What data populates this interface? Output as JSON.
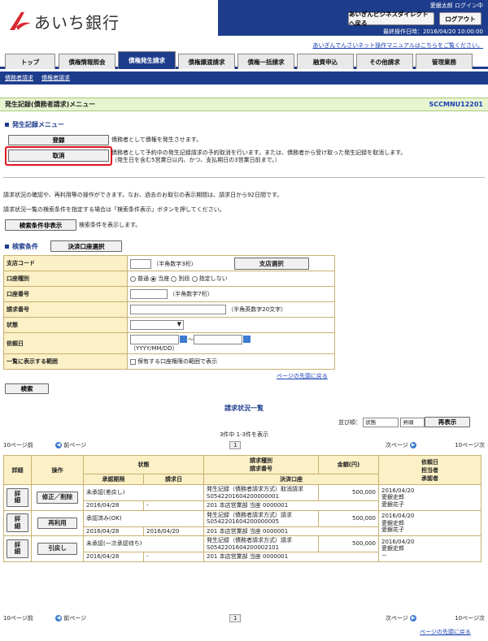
{
  "header": {
    "bank_name": "あいち銀行",
    "user": "愛銀太郎 ログイン中",
    "direct_button": "あいぎんビジネスダイレクトへ戻る",
    "logout_button": "ログアウト",
    "last_operation": "最終操作日時：2016/04/20 10:00:00",
    "manual_link": "あいぎんでんさいネット操作マニュアルはこちらをご覧ください。",
    "accent": "#1d3c8c"
  },
  "tabs": [
    "トップ",
    "債権情報照会",
    "債権発生請求",
    "債権譲渡請求",
    "債権一括請求",
    "融資申込",
    "その他請求",
    "管理業務"
  ],
  "subnav": [
    "債務者請求",
    "債権者請求"
  ],
  "title": {
    "text": "発生記録(債務者請求)メニュー",
    "code": "SCCMNU12201"
  },
  "menu": {
    "heading": "発生記録メニュー",
    "register_button": "登録",
    "register_desc": "債務者として債権を発生させます。",
    "cancel_button": "取消",
    "cancel_desc1": "債務者として予約中の発生記録請求の予約取消を行います。または、債務者から受け取った発生記録を取消します。",
    "cancel_desc2": "（発生日を含む5営業日以内、かつ、支払期日の3営業日前まで。）"
  },
  "info": {
    "line1": "請求状況の確認や、再利用等の操作ができます。なお、過去のお取引の表示期間は、請求日から92日間です。",
    "line2": "請求状況一覧の検索条件を指定する場合は「検索条件表示」ボタンを押してください。",
    "toggle_button": "検索条件非表示",
    "toggle_desc": "検索条件を表示します。"
  },
  "search": {
    "heading": "検索条件",
    "account_button": "決済口座選択",
    "branch_label": "支店コード",
    "branch_hint": "（半角数字3桁）",
    "branch_button": "支店選択",
    "acct_type_label": "口座種別",
    "acct_types": [
      "普通",
      "当座",
      "別段",
      "指定しない"
    ],
    "acct_no_label": "口座番号",
    "acct_no_hint": "（半角数字7桁）",
    "req_no_label": "請求番号",
    "req_no_hint": "（半角英数字20文字）",
    "status_label": "状態",
    "date_label": "依頼日",
    "date_sep": "～",
    "date_hint": "（YYYY/MM/DD）",
    "range_label": "一覧に表示する範囲",
    "range_option": "保有する口座権限の範囲で表示",
    "page_top": "ページの先頭に戻る",
    "search_button": "検索"
  },
  "results": {
    "title": "請求状況一覧",
    "sort_label": "並び順：",
    "sort_value": "状態",
    "order_value": "昇順",
    "sort_button": "再表示",
    "count": "3件中 1-3件を表示",
    "prev10": "10ページ前",
    "prev": "前ページ",
    "page": "1",
    "next": "次ページ",
    "next10": "10ページ次",
    "headers": {
      "detail": "詳細",
      "op": "操作",
      "status": "状態",
      "approve_deadline": "承認期限",
      "request_date": "請求日",
      "req_type": "請求種別",
      "req_no": "請求番号",
      "amount": "金額(円)",
      "account": "決済口座",
      "request_day": "依頼日",
      "staff": "担当者",
      "approver": "承認者"
    },
    "rows": [
      {
        "detail": "詳細",
        "op": "修正／削除",
        "status": "未承認(差戻し)",
        "deadline": "2016/04/28",
        "reqdate": "-",
        "type": "発生記録（債務者請求方式）取消請求",
        "no": "S0542201604200000001",
        "amount": "500,000",
        "account": "201 本店営業部 当座 0000001",
        "day": "2016/04/20",
        "staff": "愛銀史郎",
        "approver": "愛銀花子"
      },
      {
        "detail": "詳細",
        "op": "再利用",
        "status": "承認済み(OK)",
        "deadline": "2016/04/28",
        "reqdate": "2016/04/20",
        "type": "発生記録（債務者請求方式）請求",
        "no": "S0542201604200000005",
        "amount": "500,000",
        "account": "201 本店営業部 当座 0000001",
        "day": "2016/04/20",
        "staff": "愛銀史郎",
        "approver": "愛銀花子"
      },
      {
        "detail": "詳細",
        "op": "引戻し",
        "status": "未承認(一次承認待ち)",
        "deadline": "2016/04/28",
        "reqdate": "-",
        "type": "発生記録（債務者請求方式）請求",
        "no": "S0542201604200002101",
        "amount": "500,000",
        "account": "201 本店営業部 当座 0000001",
        "day": "2016/04/20",
        "staff": "愛銀史郎",
        "approver": "－"
      }
    ],
    "page_top": "ページの先頭に戻る"
  }
}
